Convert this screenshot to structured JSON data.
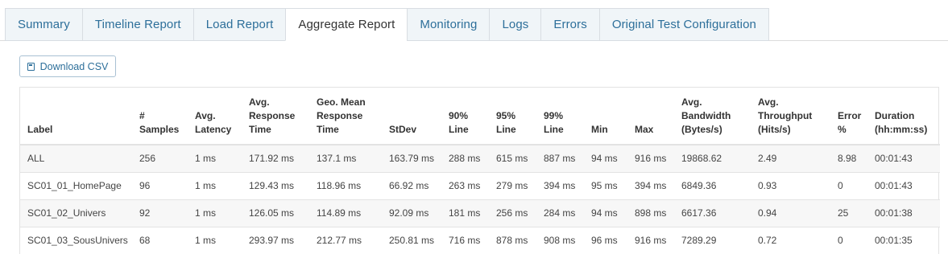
{
  "tabs": [
    {
      "label": "Summary",
      "active": false
    },
    {
      "label": "Timeline Report",
      "active": false
    },
    {
      "label": "Load Report",
      "active": false
    },
    {
      "label": "Aggregate Report",
      "active": true
    },
    {
      "label": "Monitoring",
      "active": false
    },
    {
      "label": "Logs",
      "active": false
    },
    {
      "label": "Errors",
      "active": false
    },
    {
      "label": "Original Test Configuration",
      "active": false
    }
  ],
  "toolbar": {
    "download_label": "Download CSV",
    "download_icon": "save-icon"
  },
  "table": {
    "columns": [
      "Label",
      "# Samples",
      "Avg. Latency",
      "Avg. Response Time",
      "Geo. Mean Response Time",
      "StDev",
      "90% Line",
      "95% Line",
      "99% Line",
      "Min",
      "Max",
      "Avg. Bandwidth (Bytes/s)",
      "Avg. Throughput (Hits/s)",
      "Error %",
      "Duration (hh:mm:ss)"
    ],
    "rows": [
      [
        "ALL",
        "256",
        "1 ms",
        "171.92 ms",
        "137.1 ms",
        "163.79 ms",
        "288 ms",
        "615 ms",
        "887 ms",
        "94 ms",
        "916 ms",
        "19868.62",
        "2.49",
        "8.98",
        "00:01:43"
      ],
      [
        "SC01_01_HomePage",
        "96",
        "1 ms",
        "129.43 ms",
        "118.96 ms",
        "66.92 ms",
        "263 ms",
        "279 ms",
        "394 ms",
        "95 ms",
        "394 ms",
        "6849.36",
        "0.93",
        "0",
        "00:01:43"
      ],
      [
        "SC01_02_Univers",
        "92",
        "1 ms",
        "126.05 ms",
        "114.89 ms",
        "92.09 ms",
        "181 ms",
        "256 ms",
        "284 ms",
        "94 ms",
        "898 ms",
        "6617.36",
        "0.94",
        "25",
        "00:01:38"
      ],
      [
        "SC01_03_SousUnivers",
        "68",
        "1 ms",
        "293.97 ms",
        "212.77 ms",
        "250.81 ms",
        "716 ms",
        "878 ms",
        "908 ms",
        "96 ms",
        "916 ms",
        "7289.29",
        "0.72",
        "0",
        "00:01:35"
      ]
    ]
  }
}
